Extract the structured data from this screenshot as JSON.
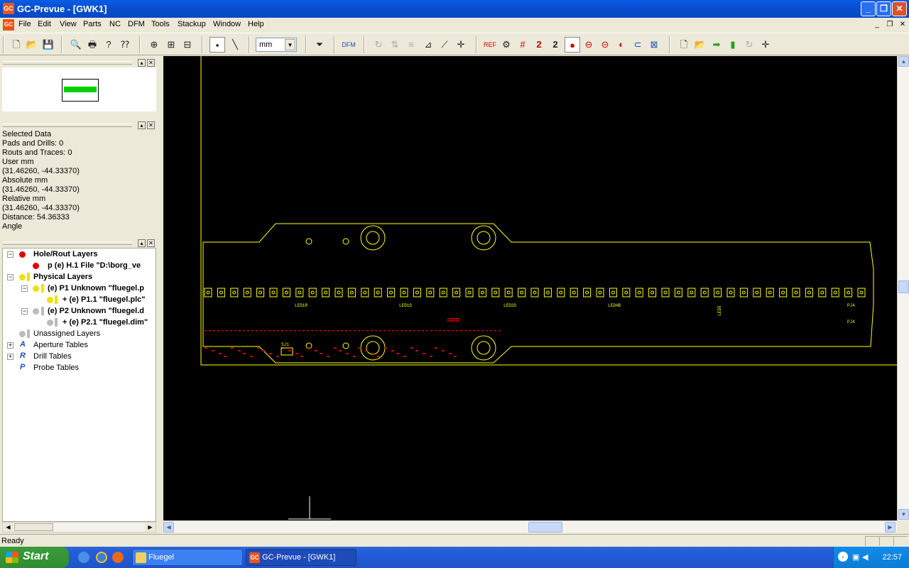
{
  "window": {
    "title": "GC-Prevue - [GWK1]",
    "app_icon": "GC",
    "min_label": "_",
    "max_label": "❐",
    "close_label": "✕"
  },
  "menu": [
    "File",
    "Edit",
    "View",
    "Parts",
    "NC",
    "DFM",
    "Tools",
    "Stackup",
    "Window",
    "Help"
  ],
  "toolbar": {
    "unit": "mm"
  },
  "preview_pane": {
    "fill_color": "#00d000"
  },
  "selection": {
    "lines": [
      "Selected Data",
      "Pads and Drills: 0",
      "Routs and Traces: 0",
      "User mm",
      "(31.46260, -44.33370)",
      "Absolute mm",
      "(31.46260, -44.33370)",
      "Relative mm",
      "(31.46260, -44.33370)",
      "Distance: 54.36333",
      "Angle"
    ]
  },
  "tree": {
    "hole_rout": "Hole/Rout Layers",
    "h1": "p (e) H.1 File \"D:\\borg_ve",
    "physical": "Physical Layers",
    "p1": "(e) P1 Unknown \"fluegel.p",
    "p11": "+ (e) P1.1 \"fluegel.plc\"",
    "p2": "(e) P2 Unknown \"fluegel.d",
    "p21": "+ (e) P2.1 \"fluegel.dim\"",
    "unassigned": "Unassigned Layers",
    "aperture": "Aperture Tables",
    "drill": "Drill Tables",
    "probe": "Probe Tables"
  },
  "canvas": {
    "labels": [
      "LED1R",
      "LED1G",
      "LED2G",
      "LED4B",
      "LED5",
      "PJ4",
      "PJ4",
      "SJ1"
    ],
    "board_color": "#ffff00",
    "red_color": "#cc0000"
  },
  "status": {
    "text": "Ready"
  },
  "taskbar": {
    "start": "Start",
    "tasks": [
      "Fluegel",
      "GC-Prevue - [GWK1]"
    ],
    "clock": "22:57"
  }
}
